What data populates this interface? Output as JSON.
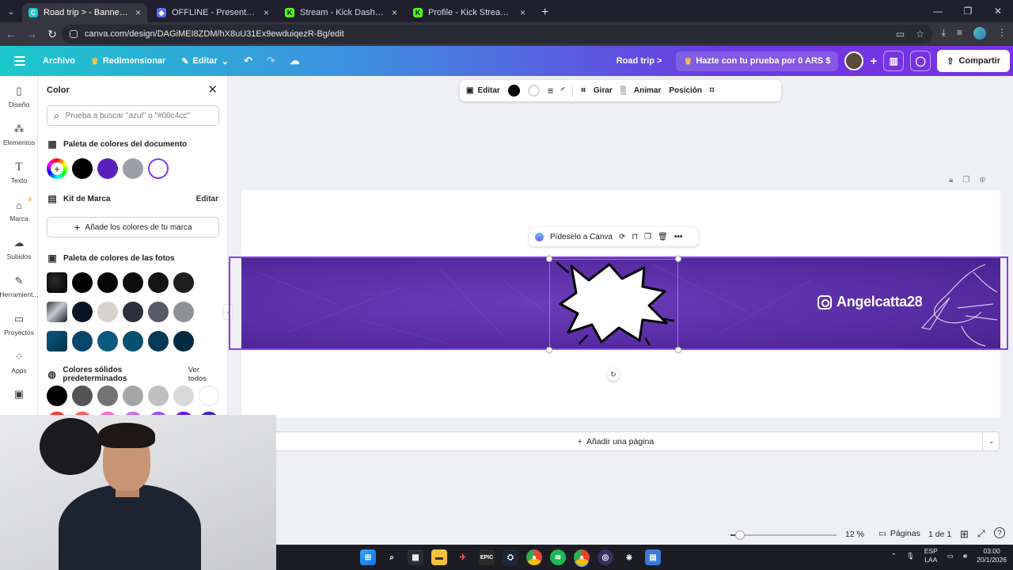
{
  "browser": {
    "tabs": [
      {
        "label": "Road trip > - Banner de exterior",
        "favicon": "canva",
        "color": "#1cc8cc",
        "active": true
      },
      {
        "label": "OFFLINE - Presentación",
        "favicon": "shield",
        "color": "#5b6cf5",
        "active": false
      },
      {
        "label": "Stream - Kick Dashboard",
        "favicon": "kick",
        "color": "#53fc18",
        "active": false
      },
      {
        "label": "Profile - Kick Streaming",
        "favicon": "kick",
        "color": "#53fc18",
        "active": false
      }
    ],
    "url": "canva.com/design/DAGiMEI8ZDM/hX8uU31Ex9ewduiqezR-Bg/edit"
  },
  "header": {
    "file": "Archivo",
    "resize": "Redimensionar",
    "edit": "Editar",
    "project_name": "Road trip >",
    "trial": "Hazte con tu prueba por 0 ARS $",
    "share": "Compartir"
  },
  "rail": [
    {
      "label": "Diseño",
      "icon": "layout-icon"
    },
    {
      "label": "Elementos",
      "icon": "shapes-icon"
    },
    {
      "label": "Texto",
      "icon": "text-icon"
    },
    {
      "label": "Marca",
      "icon": "brand-icon"
    },
    {
      "label": "Subidos",
      "icon": "cloud-upload-icon"
    },
    {
      "label": "Herramient...",
      "icon": "pen-tool-icon"
    },
    {
      "label": "Proyectos",
      "icon": "folder-icon"
    },
    {
      "label": "Apps",
      "icon": "apps-icon"
    }
  ],
  "panel": {
    "title": "Color",
    "search_placeholder": "Prueba a buscar \"azul\" o \"#00c4cc\"",
    "doc_palette_title": "Paleta de colores del documento",
    "doc_palette": [
      "#000000",
      "#5b1fc0",
      "#9aa0a8",
      "#ffffff"
    ],
    "brand_kit_title": "Kit de Marca",
    "brand_kit_edit": "Editar",
    "brand_add": "Añade los colores de tu marca",
    "photo_palette_title": "Paleta de colores de las fotos",
    "photo_rows": [
      [
        "#000000",
        "#050505",
        "#0d0d0d",
        "#151515",
        "#1e1e1e"
      ],
      [
        "#0b1422",
        "#d8d2cf",
        "#2a2f3c",
        "#565a66",
        "#8f9096"
      ],
      [
        "#08466a",
        "#0a5a80",
        "#07506f",
        "#083a58",
        "#062a40"
      ]
    ],
    "solid_title": "Colores sólidos predeterminados",
    "solid_all": "Ver todos",
    "solid_row": [
      "#000000",
      "#545454",
      "#737373",
      "#a6a6a6",
      "#bfbfbf",
      "#d9d9d9",
      "#ffffff"
    ]
  },
  "toolbar": {
    "edit": "Editar",
    "rotate": "Girar",
    "animate": "Animar",
    "position": "Posición",
    "stroke_color": "#000000",
    "fill_color": "#ffffff"
  },
  "context_menu": {
    "ask": "Pídeselo a Canva"
  },
  "banner": {
    "handle": "Angelcatta28",
    "accent": "#5a2ea6",
    "selection_color": "#8b3cf0"
  },
  "add_page": "Añadir una página",
  "footer": {
    "zoom_percent": 12,
    "zoom": "12 %",
    "pages_label": "Páginas",
    "page_count": "1 de 1"
  },
  "taskbar": {
    "lang_top": "ESP",
    "lang_bottom": "LAA",
    "time": "03:00",
    "date": "20/1/2026"
  }
}
